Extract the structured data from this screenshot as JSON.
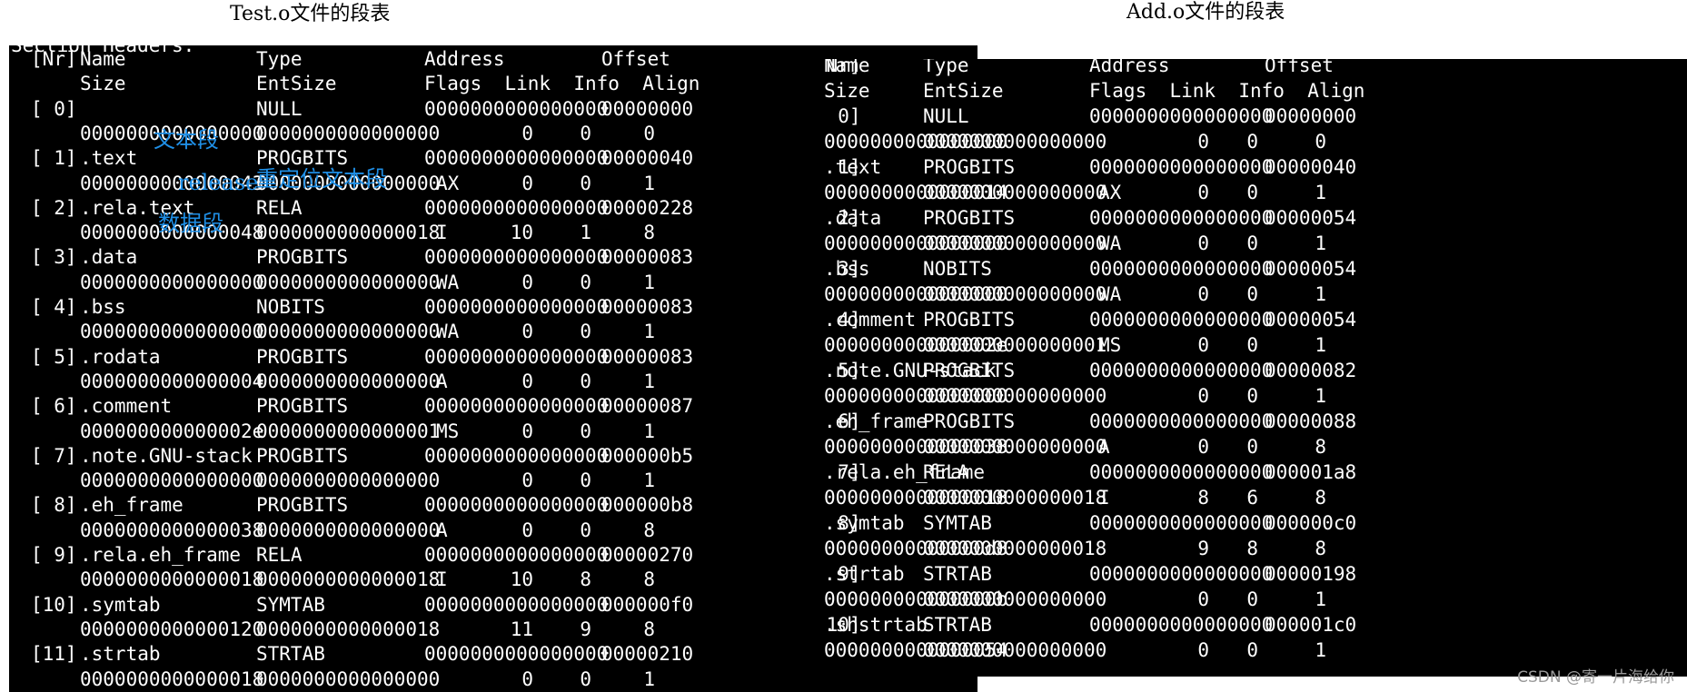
{
  "captions": {
    "left": "Test.o文件的段表",
    "right": "Add.o文件的段表"
  },
  "left_panel": {
    "cut_header": "Section Headers:",
    "header": [
      [
        "[Nr]",
        "Name",
        "Type",
        "Address",
        "Offset"
      ],
      [
        "",
        "Size",
        "EntSize",
        "Flags  Link  Info  Align",
        ""
      ]
    ],
    "sections": [
      {
        "nr": "[ 0]",
        "name": "",
        "type": "NULL",
        "address": "0000000000000000",
        "offset": "00000000",
        "size": "0000000000000000",
        "entsize": "0000000000000000",
        "flags": "",
        "link": "0",
        "info": "0",
        "align": "0"
      },
      {
        "nr": "[ 1]",
        "name": ".text",
        "type": "PROGBITS",
        "address": "0000000000000000",
        "offset": "00000040",
        "size": "0000000000000043",
        "entsize": "0000000000000000",
        "flags": "AX",
        "link": "0",
        "info": "0",
        "align": "1"
      },
      {
        "nr": "[ 2]",
        "name": ".rela.text",
        "type": "RELA",
        "address": "0000000000000000",
        "offset": "00000228",
        "size": "0000000000000048",
        "entsize": "0000000000000018",
        "flags": "I",
        "link": "10",
        "info": "1",
        "align": "8"
      },
      {
        "nr": "[ 3]",
        "name": ".data",
        "type": "PROGBITS",
        "address": "0000000000000000",
        "offset": "00000083",
        "size": "0000000000000000",
        "entsize": "0000000000000000",
        "flags": "WA",
        "link": "0",
        "info": "0",
        "align": "1"
      },
      {
        "nr": "[ 4]",
        "name": ".bss",
        "type": "NOBITS",
        "address": "0000000000000000",
        "offset": "00000083",
        "size": "0000000000000000",
        "entsize": "0000000000000000",
        "flags": "WA",
        "link": "0",
        "info": "0",
        "align": "1"
      },
      {
        "nr": "[ 5]",
        "name": ".rodata",
        "type": "PROGBITS",
        "address": "0000000000000000",
        "offset": "00000083",
        "size": "0000000000000004",
        "entsize": "0000000000000000",
        "flags": "A",
        "link": "0",
        "info": "0",
        "align": "1"
      },
      {
        "nr": "[ 6]",
        "name": ".comment",
        "type": "PROGBITS",
        "address": "0000000000000000",
        "offset": "00000087",
        "size": "000000000000002e",
        "entsize": "0000000000000001",
        "flags": "MS",
        "link": "0",
        "info": "0",
        "align": "1"
      },
      {
        "nr": "[ 7]",
        "name": ".note.GNU-stack",
        "type": "PROGBITS",
        "address": "0000000000000000",
        "offset": "000000b5",
        "size": "0000000000000000",
        "entsize": "0000000000000000",
        "flags": "",
        "link": "0",
        "info": "0",
        "align": "1"
      },
      {
        "nr": "[ 8]",
        "name": ".eh_frame",
        "type": "PROGBITS",
        "address": "0000000000000000",
        "offset": "000000b8",
        "size": "0000000000000038",
        "entsize": "0000000000000000",
        "flags": "A",
        "link": "0",
        "info": "0",
        "align": "8"
      },
      {
        "nr": "[ 9]",
        "name": ".rela.eh_frame",
        "type": "RELA",
        "address": "0000000000000000",
        "offset": "00000270",
        "size": "0000000000000018",
        "entsize": "0000000000000018",
        "flags": "I",
        "link": "10",
        "info": "8",
        "align": "8"
      },
      {
        "nr": "[10]",
        "name": ".symtab",
        "type": "SYMTAB",
        "address": "0000000000000000",
        "offset": "000000f0",
        "size": "0000000000000120",
        "entsize": "0000000000000018",
        "flags": "",
        "link": "11",
        "info": "9",
        "align": "8"
      },
      {
        "nr": "[11]",
        "name": ".strtab",
        "type": "STRTAB",
        "address": "0000000000000000",
        "offset": "00000210",
        "size": "0000000000000018",
        "entsize": "0000000000000000",
        "flags": "",
        "link": "0",
        "info": "0",
        "align": "1"
      }
    ],
    "annotations": [
      {
        "text": "文本段",
        "section": 1
      },
      {
        "text": "release",
        "section": 2
      },
      {
        "text": "重定位文本段",
        "section": 2
      },
      {
        "text": "数据段",
        "section": 3
      }
    ]
  },
  "right_panel": {
    "header": [
      [
        "[Nr]",
        "Name",
        "Type",
        "Address",
        "Offset"
      ],
      [
        "",
        "Size",
        "EntSize",
        "Flags  Link  Info  Align",
        ""
      ]
    ],
    "sections": [
      {
        "nr": "[ 0]",
        "name": "",
        "type": "NULL",
        "address": "0000000000000000",
        "offset": "00000000",
        "size": "0000000000000000",
        "entsize": "0000000000000000",
        "flags": "",
        "link": "0",
        "info": "0",
        "align": "0"
      },
      {
        "nr": "[ 1]",
        "name": ".text",
        "type": "PROGBITS",
        "address": "0000000000000000",
        "offset": "00000040",
        "size": "0000000000000014",
        "entsize": "0000000000000000",
        "flags": "AX",
        "link": "0",
        "info": "0",
        "align": "1"
      },
      {
        "nr": "[ 2]",
        "name": ".data",
        "type": "PROGBITS",
        "address": "0000000000000000",
        "offset": "00000054",
        "size": "0000000000000000",
        "entsize": "0000000000000000",
        "flags": "WA",
        "link": "0",
        "info": "0",
        "align": "1"
      },
      {
        "nr": "[ 3]",
        "name": ".bss",
        "type": "NOBITS",
        "address": "0000000000000000",
        "offset": "00000054",
        "size": "0000000000000000",
        "entsize": "0000000000000000",
        "flags": "WA",
        "link": "0",
        "info": "0",
        "align": "1"
      },
      {
        "nr": "[ 4]",
        "name": ".comment",
        "type": "PROGBITS",
        "address": "0000000000000000",
        "offset": "00000054",
        "size": "000000000000002e",
        "entsize": "0000000000000001",
        "flags": "MS",
        "link": "0",
        "info": "0",
        "align": "1"
      },
      {
        "nr": "[ 5]",
        "name": ".note.GNU-stack",
        "type": "PROGBITS",
        "address": "0000000000000000",
        "offset": "00000082",
        "size": "0000000000000000",
        "entsize": "0000000000000000",
        "flags": "",
        "link": "0",
        "info": "0",
        "align": "1"
      },
      {
        "nr": "[ 6]",
        "name": ".eh_frame",
        "type": "PROGBITS",
        "address": "0000000000000000",
        "offset": "00000088",
        "size": "0000000000000038",
        "entsize": "0000000000000000",
        "flags": "A",
        "link": "0",
        "info": "0",
        "align": "8"
      },
      {
        "nr": "[ 7]",
        "name": ".rela.eh_frame",
        "type": "RELA",
        "address": "0000000000000000",
        "offset": "000001a8",
        "size": "0000000000000018",
        "entsize": "0000000000000018",
        "flags": "I",
        "link": "8",
        "info": "6",
        "align": "8"
      },
      {
        "nr": "[ 8]",
        "name": ".symtab",
        "type": "SYMTAB",
        "address": "0000000000000000",
        "offset": "000000c0",
        "size": "00000000000000d8",
        "entsize": "0000000000000018",
        "flags": "",
        "link": "9",
        "info": "8",
        "align": "8"
      },
      {
        "nr": "[ 9]",
        "name": ".strtab",
        "type": "STRTAB",
        "address": "0000000000000000",
        "offset": "00000198",
        "size": "000000000000000b",
        "entsize": "0000000000000000",
        "flags": "",
        "link": "0",
        "info": "0",
        "align": "1"
      },
      {
        "nr": "[10]",
        "name": ".shstrtab",
        "type": "STRTAB",
        "address": "0000000000000000",
        "offset": "000001c0",
        "size": "0000000000000054",
        "entsize": "0000000000000000",
        "flags": "",
        "link": "0",
        "info": "0",
        "align": "1"
      }
    ]
  },
  "watermark": "CSDN @寄一片海给你"
}
